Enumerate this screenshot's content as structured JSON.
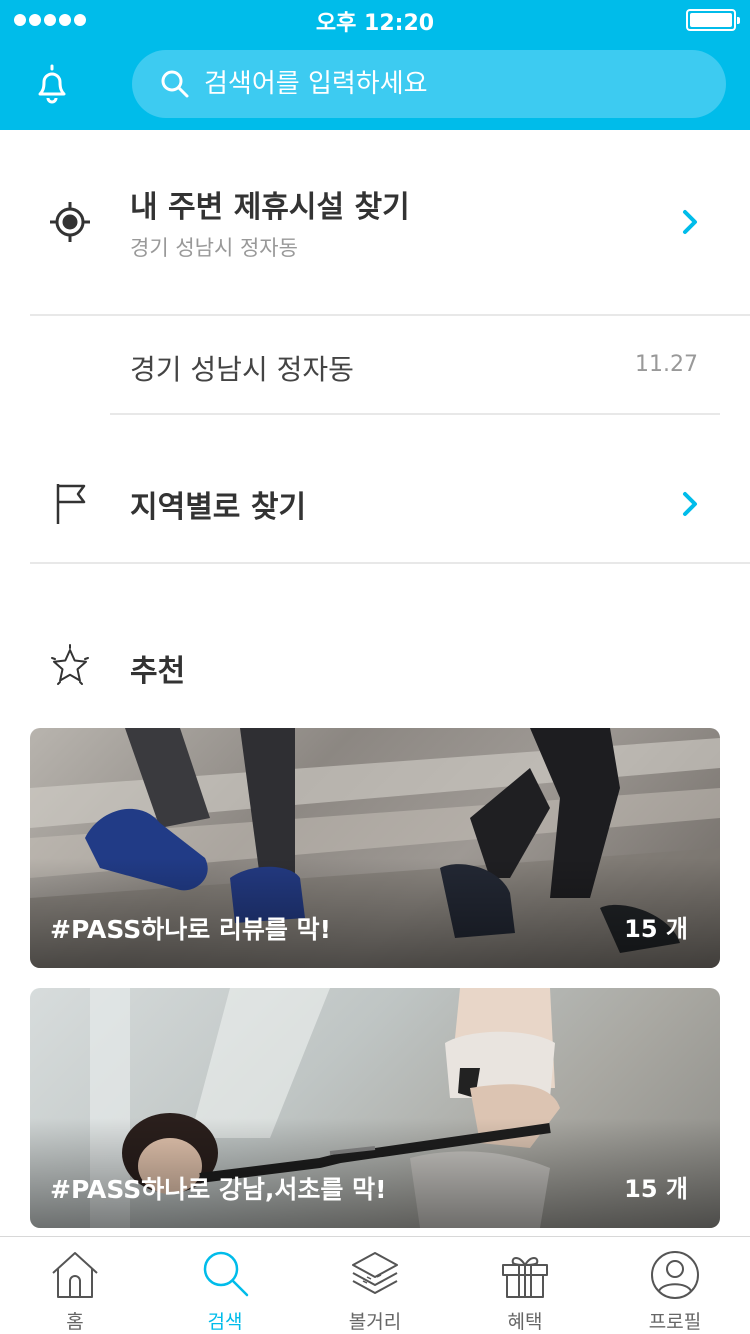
{
  "status_bar": {
    "time": "오후 12:20"
  },
  "header": {
    "search_placeholder": "검색어를 입력하세요"
  },
  "nearby": {
    "title": "내 주변 제휴시설 찾기",
    "subtitle": "경기 성남시 정자동"
  },
  "recent": {
    "address": "경기 성남시 정자동",
    "date": "11.27"
  },
  "region": {
    "title": "지역별로 찾기"
  },
  "recommend": {
    "title": "추천",
    "cards": [
      {
        "tag": "#PASS하나로 리뷰를 막!",
        "count": "15 개"
      },
      {
        "tag": "#PASS하나로 강남,서초를 막!",
        "count": "15 개"
      }
    ]
  },
  "tabbar": {
    "items": [
      {
        "label": "홈",
        "icon": "home-icon"
      },
      {
        "label": "검색",
        "icon": "search-icon"
      },
      {
        "label": "볼거리",
        "icon": "layers-icon"
      },
      {
        "label": "혜택",
        "icon": "gift-icon"
      },
      {
        "label": "프로필",
        "icon": "profile-icon"
      }
    ],
    "active": "검색"
  },
  "colors": {
    "accent": "#00bcea",
    "text": "#333333",
    "muted": "#999999"
  }
}
